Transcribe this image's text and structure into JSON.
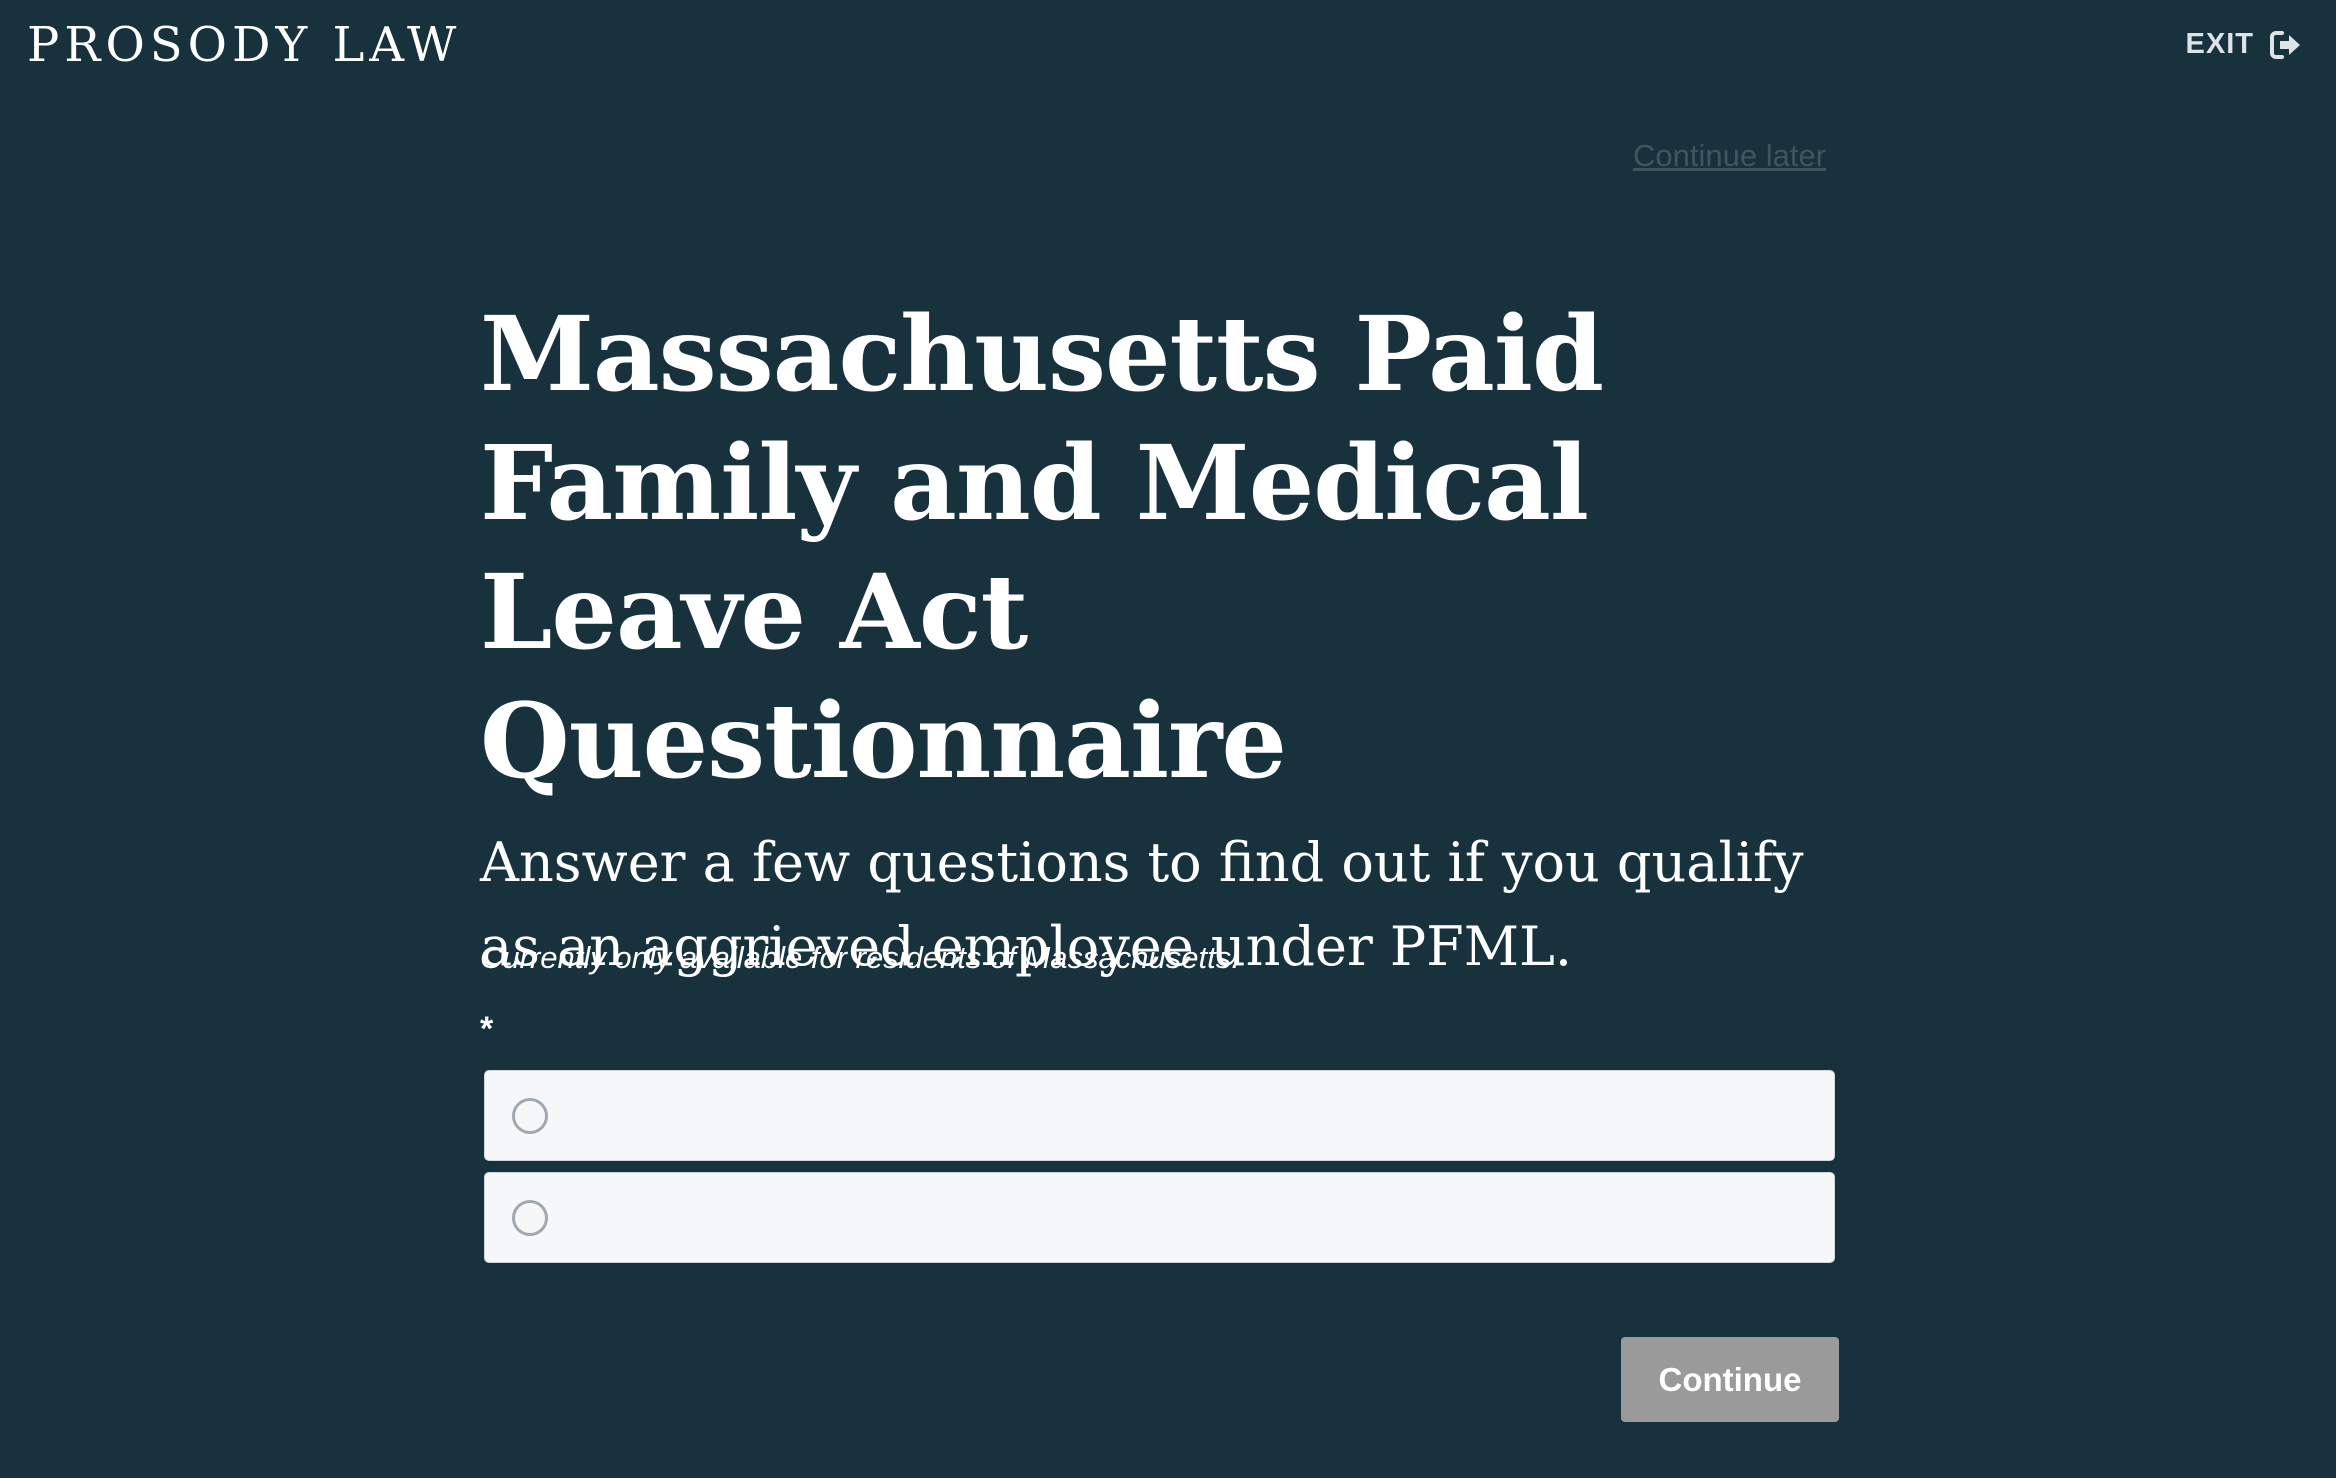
{
  "header": {
    "logo_text": "PROSODY LAW",
    "exit_label": "EXIT",
    "exit_icon": "sign-out-icon"
  },
  "continue_later_label": "Continue later",
  "main": {
    "title": "Massachusetts Paid Family and Medical Leave Act Questionnaire",
    "subtitle": "Answer a few questions to find out if you qualify as an aggrieved employee under PFML.",
    "note": "Currently only available for residents of Massachusetts.",
    "required_marker": "*",
    "options": [
      {
        "label": "",
        "selected": false
      },
      {
        "label": "",
        "selected": false
      }
    ]
  },
  "footer": {
    "continue_label": "Continue",
    "continue_disabled": true
  },
  "colors": {
    "background": "#17323c",
    "option_background": "#f6f7f9",
    "button_disabled": "#9a9a9a",
    "text": "#ffffff"
  }
}
